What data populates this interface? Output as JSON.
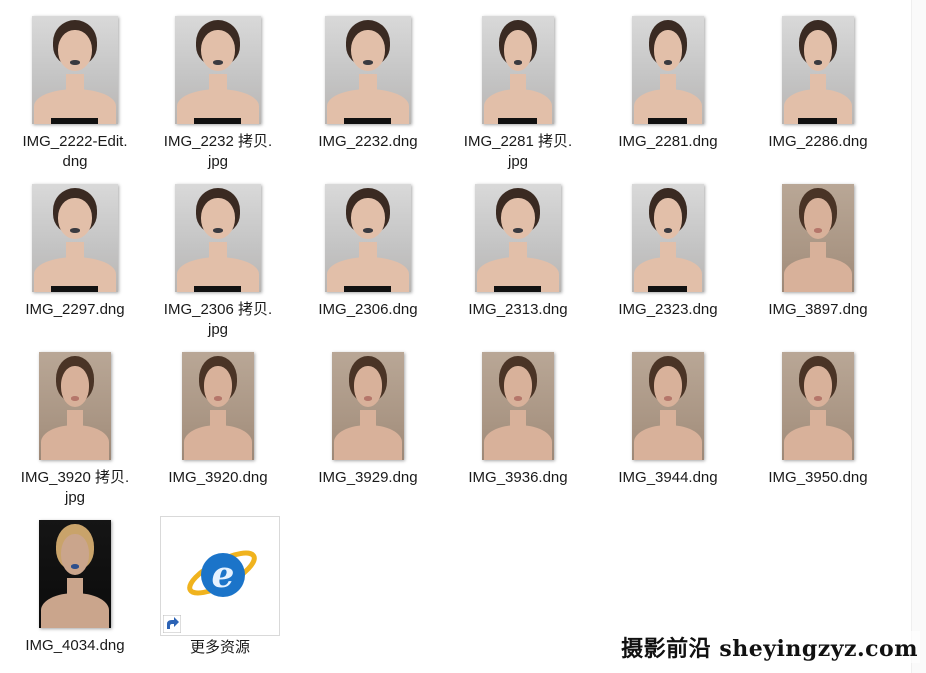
{
  "files": [
    {
      "name": "IMG_2222-Edit.\ndng",
      "lines": [
        "IMG_2222-Edit.",
        "dng"
      ],
      "tone": "light"
    },
    {
      "name": "IMG_2232 拷贝.jpg",
      "lines": [
        "IMG_2232 拷贝.",
        "jpg"
      ],
      "tone": "light"
    },
    {
      "name": "IMG_2232.dng",
      "lines": [
        "IMG_2232.dng"
      ],
      "tone": "light"
    },
    {
      "name": "IMG_2281 拷贝.jpg",
      "lines": [
        "IMG_2281 拷贝.",
        "jpg"
      ],
      "tone": "light"
    },
    {
      "name": "IMG_2281.dng",
      "lines": [
        "IMG_2281.dng"
      ],
      "tone": "light"
    },
    {
      "name": "IMG_2286.dng",
      "lines": [
        "IMG_2286.dng"
      ],
      "tone": "light"
    },
    {
      "name": "IMG_2297.dng",
      "lines": [
        "IMG_2297.dng"
      ],
      "tone": "light"
    },
    {
      "name": "IMG_2306 拷贝.jpg",
      "lines": [
        "IMG_2306 拷贝.",
        "jpg"
      ],
      "tone": "light"
    },
    {
      "name": "IMG_2306.dng",
      "lines": [
        "IMG_2306.dng"
      ],
      "tone": "light"
    },
    {
      "name": "IMG_2313.dng",
      "lines": [
        "IMG_2313.dng"
      ],
      "tone": "light"
    },
    {
      "name": "IMG_2323.dng",
      "lines": [
        "IMG_2323.dng"
      ],
      "tone": "light"
    },
    {
      "name": "IMG_3897.dng",
      "lines": [
        "IMG_3897.dng"
      ],
      "tone": "beige"
    },
    {
      "name": "IMG_3920 拷贝.jpg",
      "lines": [
        "IMG_3920 拷贝.",
        "jpg"
      ],
      "tone": "beige"
    },
    {
      "name": "IMG_3920.dng",
      "lines": [
        "IMG_3920.dng"
      ],
      "tone": "beige"
    },
    {
      "name": "IMG_3929.dng",
      "lines": [
        "IMG_3929.dng"
      ],
      "tone": "beige"
    },
    {
      "name": "IMG_3936.dng",
      "lines": [
        "IMG_3936.dng"
      ],
      "tone": "beige"
    },
    {
      "name": "IMG_3944.dng",
      "lines": [
        "IMG_3944.dng"
      ],
      "tone": "beige"
    },
    {
      "name": "IMG_3950.dng",
      "lines": [
        "IMG_3950.dng"
      ],
      "tone": "beige"
    },
    {
      "name": "IMG_4034.dng",
      "lines": [
        "IMG_4034.dng"
      ],
      "tone": "dark"
    }
  ],
  "shortcut": {
    "label": "更多资源",
    "icon": "internet-explorer-icon",
    "overlay_icon": "shortcut-arrow-icon"
  },
  "watermark": "摄影前沿 sheyingzyz.com",
  "colors": {
    "ie_blue": "#1b74c9",
    "ie_gold": "#f0b31e",
    "shortcut_arrow": "#2c63b5"
  }
}
